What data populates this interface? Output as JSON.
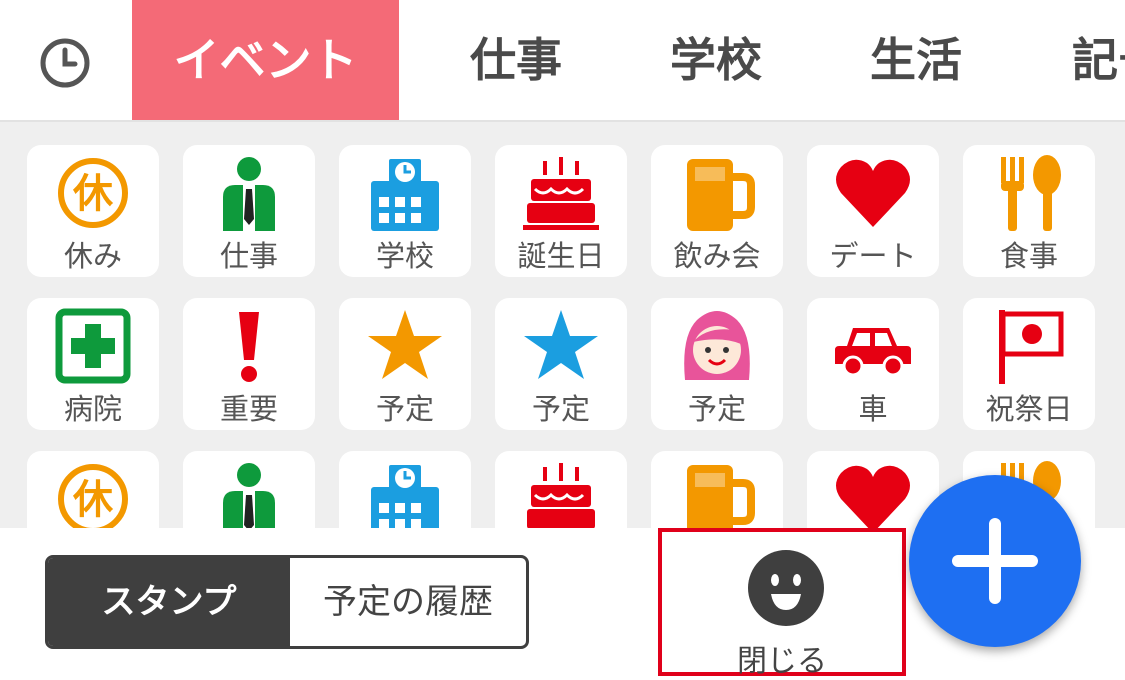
{
  "tabs": [
    {
      "label": "イベント",
      "active": true
    },
    {
      "label": "仕事"
    },
    {
      "label": "学校"
    },
    {
      "label": "生活"
    },
    {
      "label": "記号"
    }
  ],
  "stamps": {
    "row1": [
      "休み",
      "仕事",
      "学校",
      "誕生日",
      "飲み会",
      "デート",
      "食事"
    ],
    "row2": [
      "病院",
      "重要",
      "予定",
      "予定",
      "予定",
      "車",
      "祝祭日"
    ],
    "holiday_glyph": "休"
  },
  "segment": {
    "stamps_label": "スタンプ",
    "history_label": "予定の履歴"
  },
  "close_label": "閉じる",
  "colors": {
    "accent": "#f46a77",
    "fab": "#1e6ff2",
    "highlight": "#e0001a"
  }
}
